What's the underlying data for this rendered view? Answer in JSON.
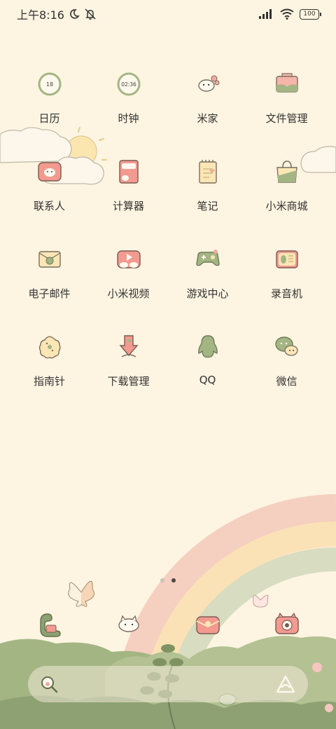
{
  "status_bar": {
    "time": "上午8:16",
    "battery": "100"
  },
  "apps": [
    {
      "label": "日历",
      "icon": "calendar-icon",
      "badge": "18"
    },
    {
      "label": "时钟",
      "icon": "clock-icon",
      "badge": "02:36"
    },
    {
      "label": "米家",
      "icon": "mijia-icon"
    },
    {
      "label": "文件管理",
      "icon": "file-manager-icon"
    },
    {
      "label": "联系人",
      "icon": "contacts-icon"
    },
    {
      "label": "计算器",
      "icon": "calculator-icon"
    },
    {
      "label": "笔记",
      "icon": "notes-icon"
    },
    {
      "label": "小米商城",
      "icon": "mi-store-icon"
    },
    {
      "label": "电子邮件",
      "icon": "email-icon"
    },
    {
      "label": "小米视频",
      "icon": "mi-video-icon"
    },
    {
      "label": "游戏中心",
      "icon": "game-center-icon"
    },
    {
      "label": "录音机",
      "icon": "recorder-icon"
    },
    {
      "label": "指南针",
      "icon": "compass-icon"
    },
    {
      "label": "下载管理",
      "icon": "download-manager-icon"
    },
    {
      "label": "QQ",
      "icon": "qq-icon"
    },
    {
      "label": "微信",
      "icon": "wechat-icon"
    }
  ],
  "page_indicator": {
    "count": 2,
    "active": 2
  },
  "dock": [
    {
      "icon": "phone-icon"
    },
    {
      "icon": "cat-icon"
    },
    {
      "icon": "messages-icon"
    },
    {
      "icon": "camera-icon"
    }
  ],
  "search": {
    "icon": "search-icon",
    "assistant_icon": "assistant-icon"
  },
  "colors": {
    "background": "#fdf4e1",
    "green": "#a4b584",
    "pink": "#f4a9a0",
    "rainbow_pink": "#f5cfc0",
    "rainbow_yellow": "#fbe2b6",
    "rainbow_green": "#d8dcc0"
  }
}
